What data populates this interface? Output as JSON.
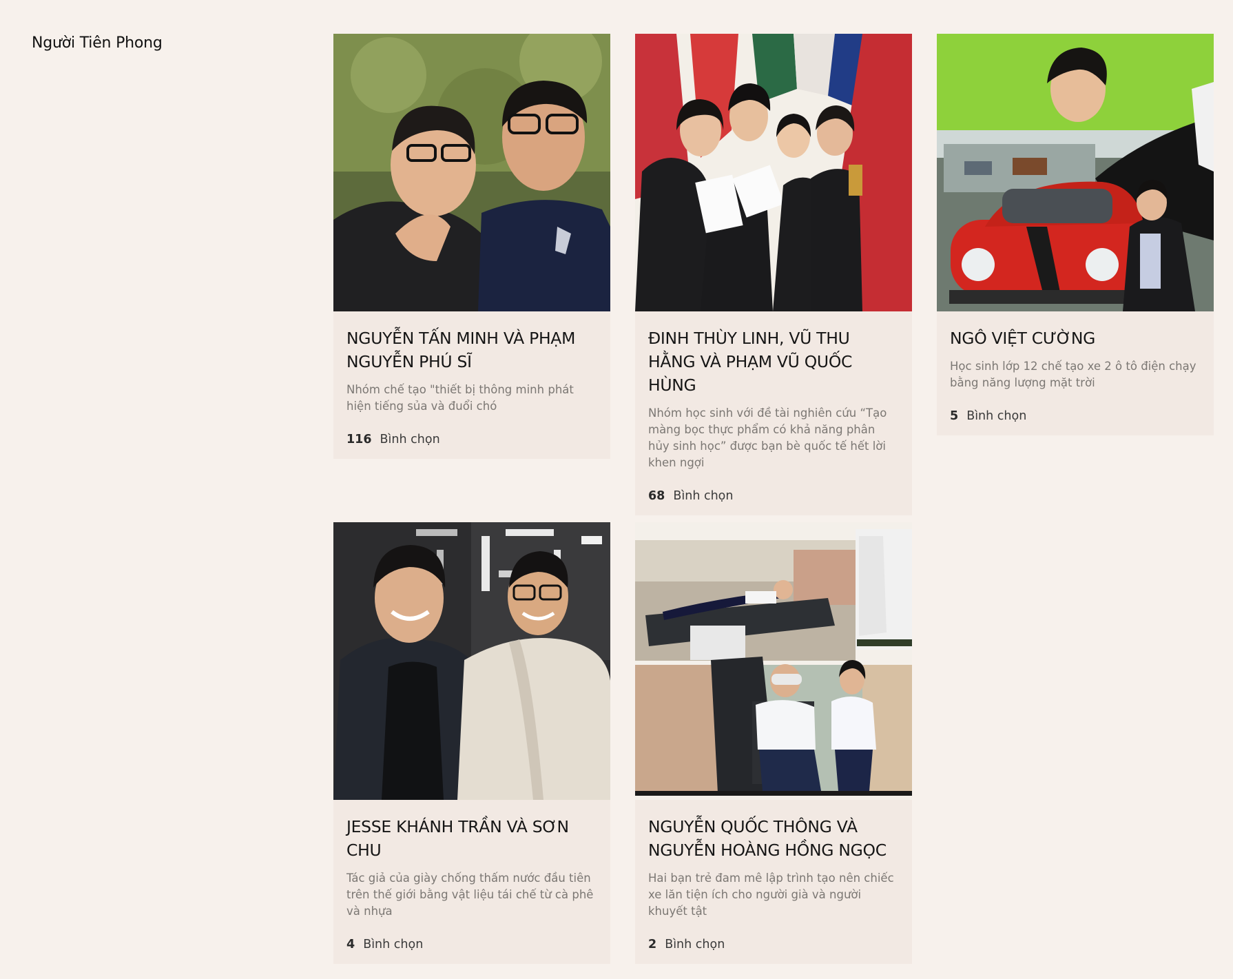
{
  "category": {
    "title": "Người Tiên Phong"
  },
  "cards": [
    {
      "name": "Nguyễn Tấn Minh và Phạm Nguyễn Phú Sĩ",
      "description": "Nhóm chế tạo \"thiết bị thông minh phát hiện tiếng sủa và đuổi chó",
      "vote_count": "116",
      "vote_label": "Bình chọn"
    },
    {
      "name": "Đinh Thùy Linh, Vũ Thu Hằng và Phạm Vũ Quốc Hùng",
      "description": "Nhóm học sinh với đề tài nghiên cứu “Tạo màng bọc thực phẩm có khả năng phân hủy sinh học” được bạn bè quốc tế hết lời khen ngợi",
      "vote_count": "68",
      "vote_label": "Bình chọn"
    },
    {
      "name": "Ngô Việt Cường",
      "description": "Học sinh lớp 12 chế tạo xe 2 ô tô điện chạy bằng năng lượng mặt trời",
      "vote_count": "5",
      "vote_label": "Bình chọn"
    },
    {
      "name": "Jesse Khánh Trần và Sơn Chu",
      "description": "Tác giả của giày chống thấm nước đầu tiên trên thế giới bằng vật liệu tái chế từ cà phê và nhựa",
      "vote_count": "4",
      "vote_label": "Bình chọn"
    },
    {
      "name": "Nguyễn Quốc Thông và Nguyễn Hoàng Hồng Ngọc",
      "description": "Hai bạn trẻ đam mê lập trình tạo nên chiếc xe lăn tiện ích cho người già và người khuyết tật",
      "vote_count": "2",
      "vote_label": "Bình chọn"
    }
  ],
  "colors": {
    "page_background": "#f7f1ec",
    "card_background": "#f2e9e3",
    "description_text": "#7b7773"
  }
}
